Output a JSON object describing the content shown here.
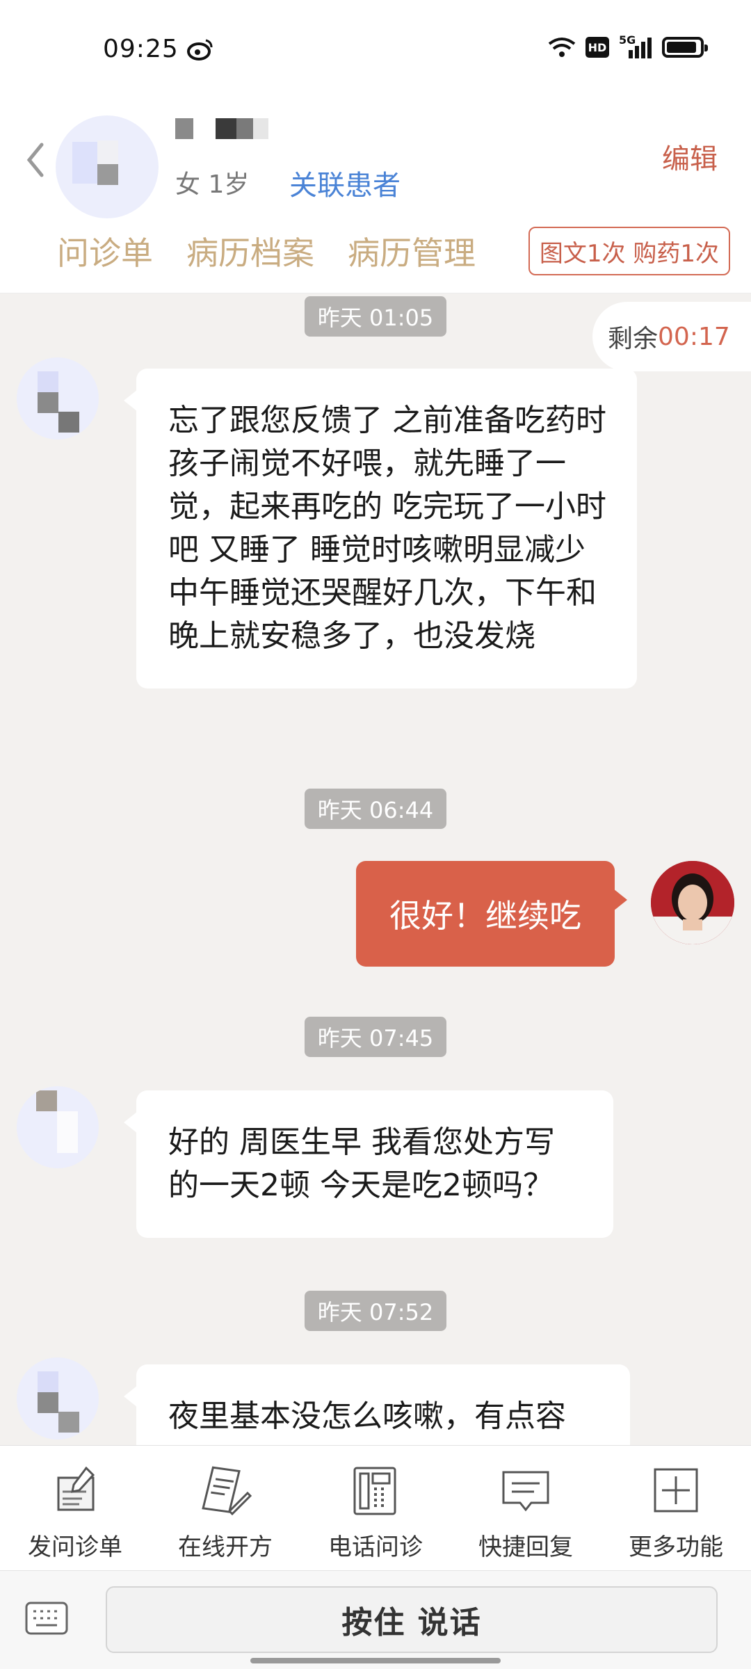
{
  "status_bar": {
    "time": "09:25",
    "network": "5G",
    "hd": "HD"
  },
  "header": {
    "gender_age": "女 1岁",
    "link_patient": "关联患者",
    "edit": "编辑",
    "tabs": [
      "问诊单",
      "病历档案",
      "病历管理"
    ],
    "service_badge": "图文1次 购药1次"
  },
  "chat": {
    "timer_label": "剩余",
    "timer_value": "00:17",
    "messages": [
      {
        "time": "昨天 01:05",
        "text": "忘了跟您反馈了 之前准备吃药时孩子闹觉不好喂，就先睡了一觉，起来再吃的 吃完玩了一小时吧 又睡了 睡觉时咳嗽明显减少 中午睡觉还哭醒好几次，下午和晚上就安稳多了，也没发烧"
      },
      {
        "time": "昨天 06:44",
        "text": "很好！继续吃"
      },
      {
        "time": "昨天 07:45",
        "text": "好的 周医生早 我看您处方写的一天2顿 今天是吃2顿吗？"
      },
      {
        "time": "昨天 07:52",
        "text": "夜里基本没怎么咳嗽，有点容"
      }
    ]
  },
  "toolbar": [
    {
      "label": "发问诊单",
      "icon": "form-icon"
    },
    {
      "label": "在线开方",
      "icon": "prescription-icon"
    },
    {
      "label": "电话问诊",
      "icon": "phone-icon"
    },
    {
      "label": "快捷回复",
      "icon": "quick-reply-icon"
    },
    {
      "label": "更多功能",
      "icon": "plus-icon"
    }
  ],
  "input": {
    "talk_label": "按住 说话"
  },
  "colors": {
    "accent": "#d9614a",
    "tab_text": "#c9ac81",
    "link": "#4a83d6"
  }
}
